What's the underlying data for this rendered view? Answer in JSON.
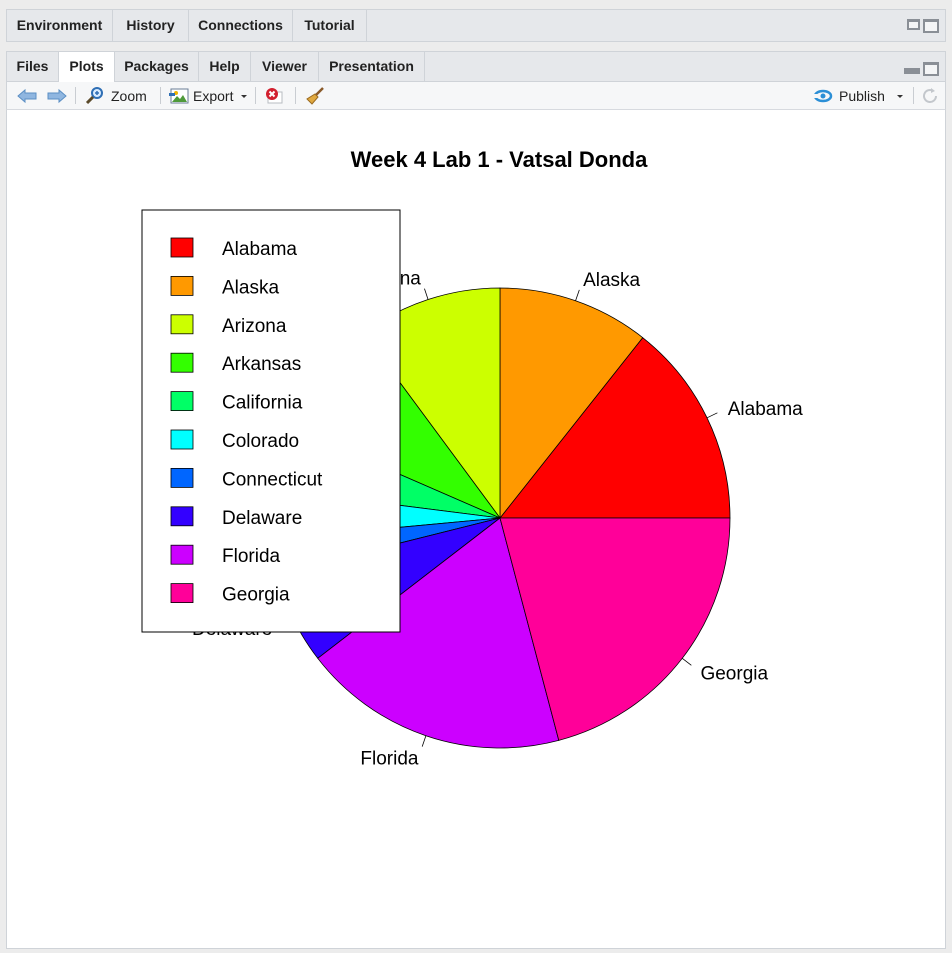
{
  "top_panel": {
    "tabs": [
      "Environment",
      "History",
      "Connections",
      "Tutorial"
    ]
  },
  "bottom_panel": {
    "tabs": [
      "Files",
      "Plots",
      "Packages",
      "Help",
      "Viewer",
      "Presentation"
    ],
    "active_tab": "Plots"
  },
  "toolbar": {
    "zoom_label": "Zoom",
    "export_label": "Export",
    "publish_label": "Publish"
  },
  "icons": {
    "back": "arrow-left-icon",
    "forward": "arrow-right-icon",
    "zoom": "magnifier-icon",
    "export": "image-export-icon",
    "remove": "remove-plot-icon",
    "clear": "broom-icon",
    "publish": "publish-icon",
    "refresh": "refresh-icon"
  },
  "chart_data": {
    "type": "pie",
    "title": "Week 4 Lab 1 - Vatsal Donda",
    "categories": [
      "Alabama",
      "Alaska",
      "Arizona",
      "Arkansas",
      "California",
      "Colorado",
      "Connecticut",
      "Delaware",
      "Florida",
      "Georgia"
    ],
    "values": [
      13.6,
      10.1,
      9.6,
      7.9,
      4.3,
      3.3,
      2.3,
      6.2,
      17.7,
      19.8
    ],
    "colors": [
      "#FF0000",
      "#FF9900",
      "#CCFF00",
      "#33FF00",
      "#00FF66",
      "#00FFFF",
      "#0066FF",
      "#3300FF",
      "#CC00FF",
      "#FF0099"
    ],
    "legend": "top-left",
    "start_angle": "3 o'clock, counter-clockwise"
  }
}
